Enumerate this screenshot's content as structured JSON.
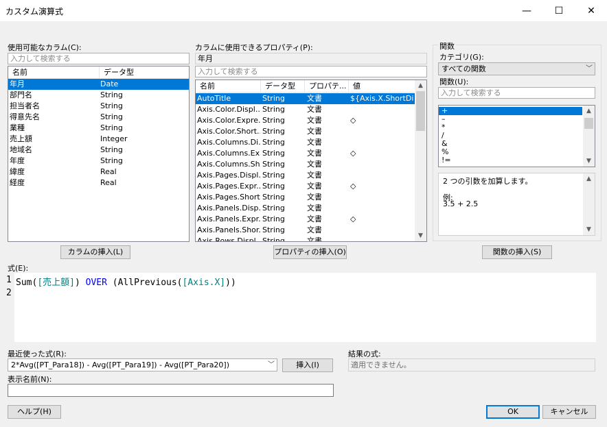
{
  "window": {
    "title": "カスタム演算式",
    "minimize": "—",
    "maximize": "☐",
    "close": "✕"
  },
  "columns_panel": {
    "label": "使用可能なカラム(C):",
    "search_placeholder": "入力して検索する",
    "headers": [
      "名前",
      "データ型"
    ],
    "rows": [
      {
        "name": "年月",
        "type": "Date"
      },
      {
        "name": "部門名",
        "type": "String"
      },
      {
        "name": "担当者名",
        "type": "String"
      },
      {
        "name": "得意先名",
        "type": "String"
      },
      {
        "name": "業種",
        "type": "String"
      },
      {
        "name": "売上額",
        "type": "Integer"
      },
      {
        "name": "地域名",
        "type": "String"
      },
      {
        "name": "年度",
        "type": "String"
      },
      {
        "name": "緯度",
        "type": "Real"
      },
      {
        "name": "経度",
        "type": "Real"
      }
    ],
    "insert_button": "カラムの挿入(L)"
  },
  "properties_panel": {
    "label": "カラムに使用できるプロパティ(P):",
    "selected_column": "年月",
    "search_placeholder": "入力して検索する",
    "headers": [
      "名前",
      "データ型",
      "プロパテ...",
      "値"
    ],
    "rows": [
      {
        "name": "AutoTitle",
        "type": "String",
        "prop": "文書",
        "value": "${Axis.X.ShortDi..."
      },
      {
        "name": "Axis.Color.Displ...",
        "type": "String",
        "prop": "文書",
        "value": ""
      },
      {
        "name": "Axis.Color.Expre...",
        "type": "String",
        "prop": "文書",
        "value": "◇"
      },
      {
        "name": "Axis.Color.Short...",
        "type": "String",
        "prop": "文書",
        "value": ""
      },
      {
        "name": "Axis.Columns.Di...",
        "type": "String",
        "prop": "文書",
        "value": ""
      },
      {
        "name": "Axis.Columns.Ex...",
        "type": "String",
        "prop": "文書",
        "value": "◇"
      },
      {
        "name": "Axis.Columns.Sh...",
        "type": "String",
        "prop": "文書",
        "value": ""
      },
      {
        "name": "Axis.Pages.Displ...",
        "type": "String",
        "prop": "文書",
        "value": ""
      },
      {
        "name": "Axis.Pages.Expr...",
        "type": "String",
        "prop": "文書",
        "value": "◇"
      },
      {
        "name": "Axis.Pages.Short...",
        "type": "String",
        "prop": "文書",
        "value": ""
      },
      {
        "name": "Axis.Panels.Disp...",
        "type": "String",
        "prop": "文書",
        "value": ""
      },
      {
        "name": "Axis.Panels.Expr...",
        "type": "String",
        "prop": "文書",
        "value": "◇"
      },
      {
        "name": "Axis.Panels.Shor...",
        "type": "String",
        "prop": "文書",
        "value": ""
      },
      {
        "name": "Axis.Rows.Displ...",
        "type": "String",
        "prop": "文書",
        "value": ""
      }
    ],
    "insert_button": "プロパティの挿入(O)"
  },
  "functions_panel": {
    "group_label": "関数",
    "category_label": "カテゴリ(G):",
    "category_value": "すべての関数",
    "functions_label": "関数(U):",
    "search_placeholder": "入力して検索する",
    "items": [
      "+",
      "–",
      "*",
      "/",
      "&",
      "%",
      "!="
    ],
    "description": "2 つの引数を加算します。",
    "example_label": "例:",
    "example_value": "3.5 + 2.5",
    "insert_button": "関数の挿入(S)"
  },
  "expression": {
    "label": "式(E):",
    "line1_number": "1",
    "line2_number": "2",
    "tokens": {
      "fn1": "Sum(",
      "col": "[売上額]",
      "close1": ")",
      "over": "OVER",
      "fn2": "(AllPrevious(",
      "axis": "[Axis.X]",
      "close2": "))"
    },
    "colors": {
      "keyword": "#0000ff",
      "column": "#008080",
      "text": "#000000"
    }
  },
  "recent": {
    "label": "最近使った式(R):",
    "value": "2*Avg([PT_Para18]) - Avg([PT_Para19]) - Avg([PT_Para20])",
    "insert_button": "挿入(I)"
  },
  "result": {
    "label": "結果の式:",
    "value": "適用できません。"
  },
  "display_name": {
    "label": "表示名前(N):",
    "value": ""
  },
  "footer": {
    "help_button": "ヘルプ(H)",
    "ok_button": "OK",
    "cancel_button": "キャンセル"
  }
}
